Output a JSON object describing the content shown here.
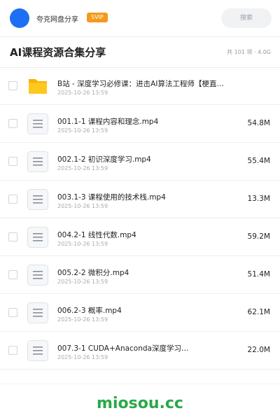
{
  "header": {
    "sharer_name": "夸克网盘分享",
    "badge": "SVIP",
    "search_label": "搜索",
    "accent_color": "#1f6ff5"
  },
  "collection": {
    "title": "AI课程资源合集分享",
    "meta": "共 101 项 · 4.0G"
  },
  "files": [
    {
      "name": "B站 - 深度学习必修课：进击AI算法工程师【梗直…",
      "date": "2025-10-26 13:59",
      "size": "",
      "type": "folder"
    },
    {
      "name": "001.1-1 课程内容和理念.mp4",
      "date": "2025-10-26 13:59",
      "size": "54.8M",
      "type": "file"
    },
    {
      "name": "002.1-2 初识深度学习.mp4",
      "date": "2025-10-26 13:59",
      "size": "55.4M",
      "type": "file"
    },
    {
      "name": "003.1-3 课程使用的技术栈.mp4",
      "date": "2025-10-26 13:59",
      "size": "13.3M",
      "type": "file"
    },
    {
      "name": "004.2-1 线性代数.mp4",
      "date": "2025-10-26 13:59",
      "size": "59.2M",
      "type": "file"
    },
    {
      "name": "005.2-2 微积分.mp4",
      "date": "2025-10-26 13:59",
      "size": "51.4M",
      "type": "file"
    },
    {
      "name": "006.2-3 概率.mp4",
      "date": "2025-10-26 13:59",
      "size": "62.1M",
      "type": "file"
    },
    {
      "name": "007.3-1 CUDA+Anaconda深度学习…",
      "date": "2025-10-26 13:59",
      "size": "22.0M",
      "type": "file"
    }
  ],
  "footer": {
    "logo_text": "miosou.cc"
  }
}
